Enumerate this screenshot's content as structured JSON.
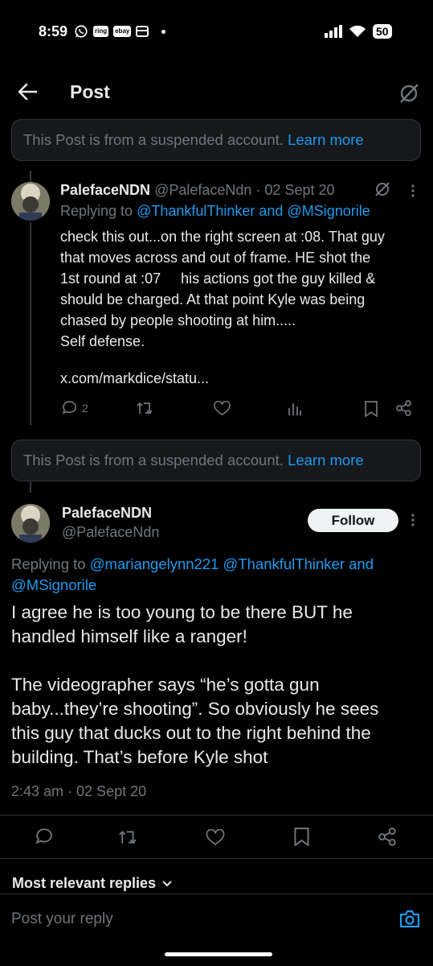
{
  "status_bar": {
    "time": "8:59",
    "badges": [
      "ring",
      "ebay"
    ],
    "battery": "50"
  },
  "header": {
    "title": "Post"
  },
  "suspended_notice": {
    "text": "This Post is from a suspended account.",
    "link": "Learn more"
  },
  "reply_post": {
    "name": "PalefaceNDN",
    "meta": "@PalefaceNdn · 02 Sept 20",
    "replying_prefix": "Replying to",
    "replying_to": "@ThankfulThinker and @MSignorile",
    "lines": [
      "check this out...on the right screen at :08. That guy",
      "that moves across and out of frame. HE shot the",
      "1st round at :07     his actions got the guy killed &",
      "should be charged. At that point Kyle was being",
      "chased by people shooting at him.....",
      "Self defense."
    ],
    "link": "x.com/markdice/statu...",
    "reply_count": "2"
  },
  "main_post": {
    "name": "PalefaceNDN",
    "handle": "@PalefaceNdn",
    "follow_label": "Follow",
    "replying_prefix": "Replying to",
    "replying_line1": "@mariangelynn221 @ThankfulThinker and",
    "replying_line2": "@MSignorile",
    "lines": [
      "I agree he is too young to be there BUT he",
      "handled himself like a ranger!",
      "",
      "The videographer says “he’s gotta gun",
      "baby...they’re shooting”. So obviously he sees",
      "this guy that ducks out to the right behind the",
      "building. That’s before Kyle shot"
    ],
    "timestamp": "2:43 am · 02 Sept 20"
  },
  "replies_filter": {
    "label": "Most relevant replies"
  },
  "reply_box": {
    "placeholder": "Post your reply"
  },
  "colors": {
    "accent": "#1d9bf0",
    "background": "#000000",
    "muted": "#71767b"
  }
}
